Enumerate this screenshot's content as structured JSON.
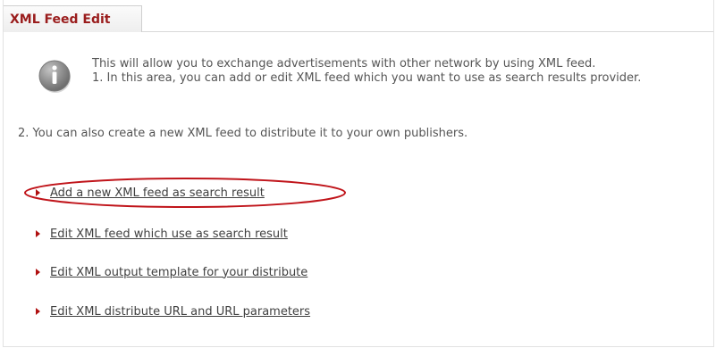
{
  "panel": {
    "title": "XML Feed Edit"
  },
  "info": {
    "icon": "info-icon",
    "intro": "This will allow you to exchange advertisements with other network by using XML feed.",
    "point1": "1. In this area, you can add or edit XML feed which you want to use as search results provider.",
    "point2": "2. You can also create a new XML feed to distribute it to your own publishers."
  },
  "links": [
    {
      "label": "Add a new XML feed as search result",
      "highlighted": true
    },
    {
      "label": "Edit XML feed which use as search result",
      "highlighted": false
    },
    {
      "label": "Edit XML output template for your distribute",
      "highlighted": false
    },
    {
      "label": "Edit XML distribute URL and URL parameters",
      "highlighted": false
    }
  ],
  "colors": {
    "title": "#9a1d1d",
    "arrow": "#b01010",
    "highlight": "#c0141a"
  }
}
